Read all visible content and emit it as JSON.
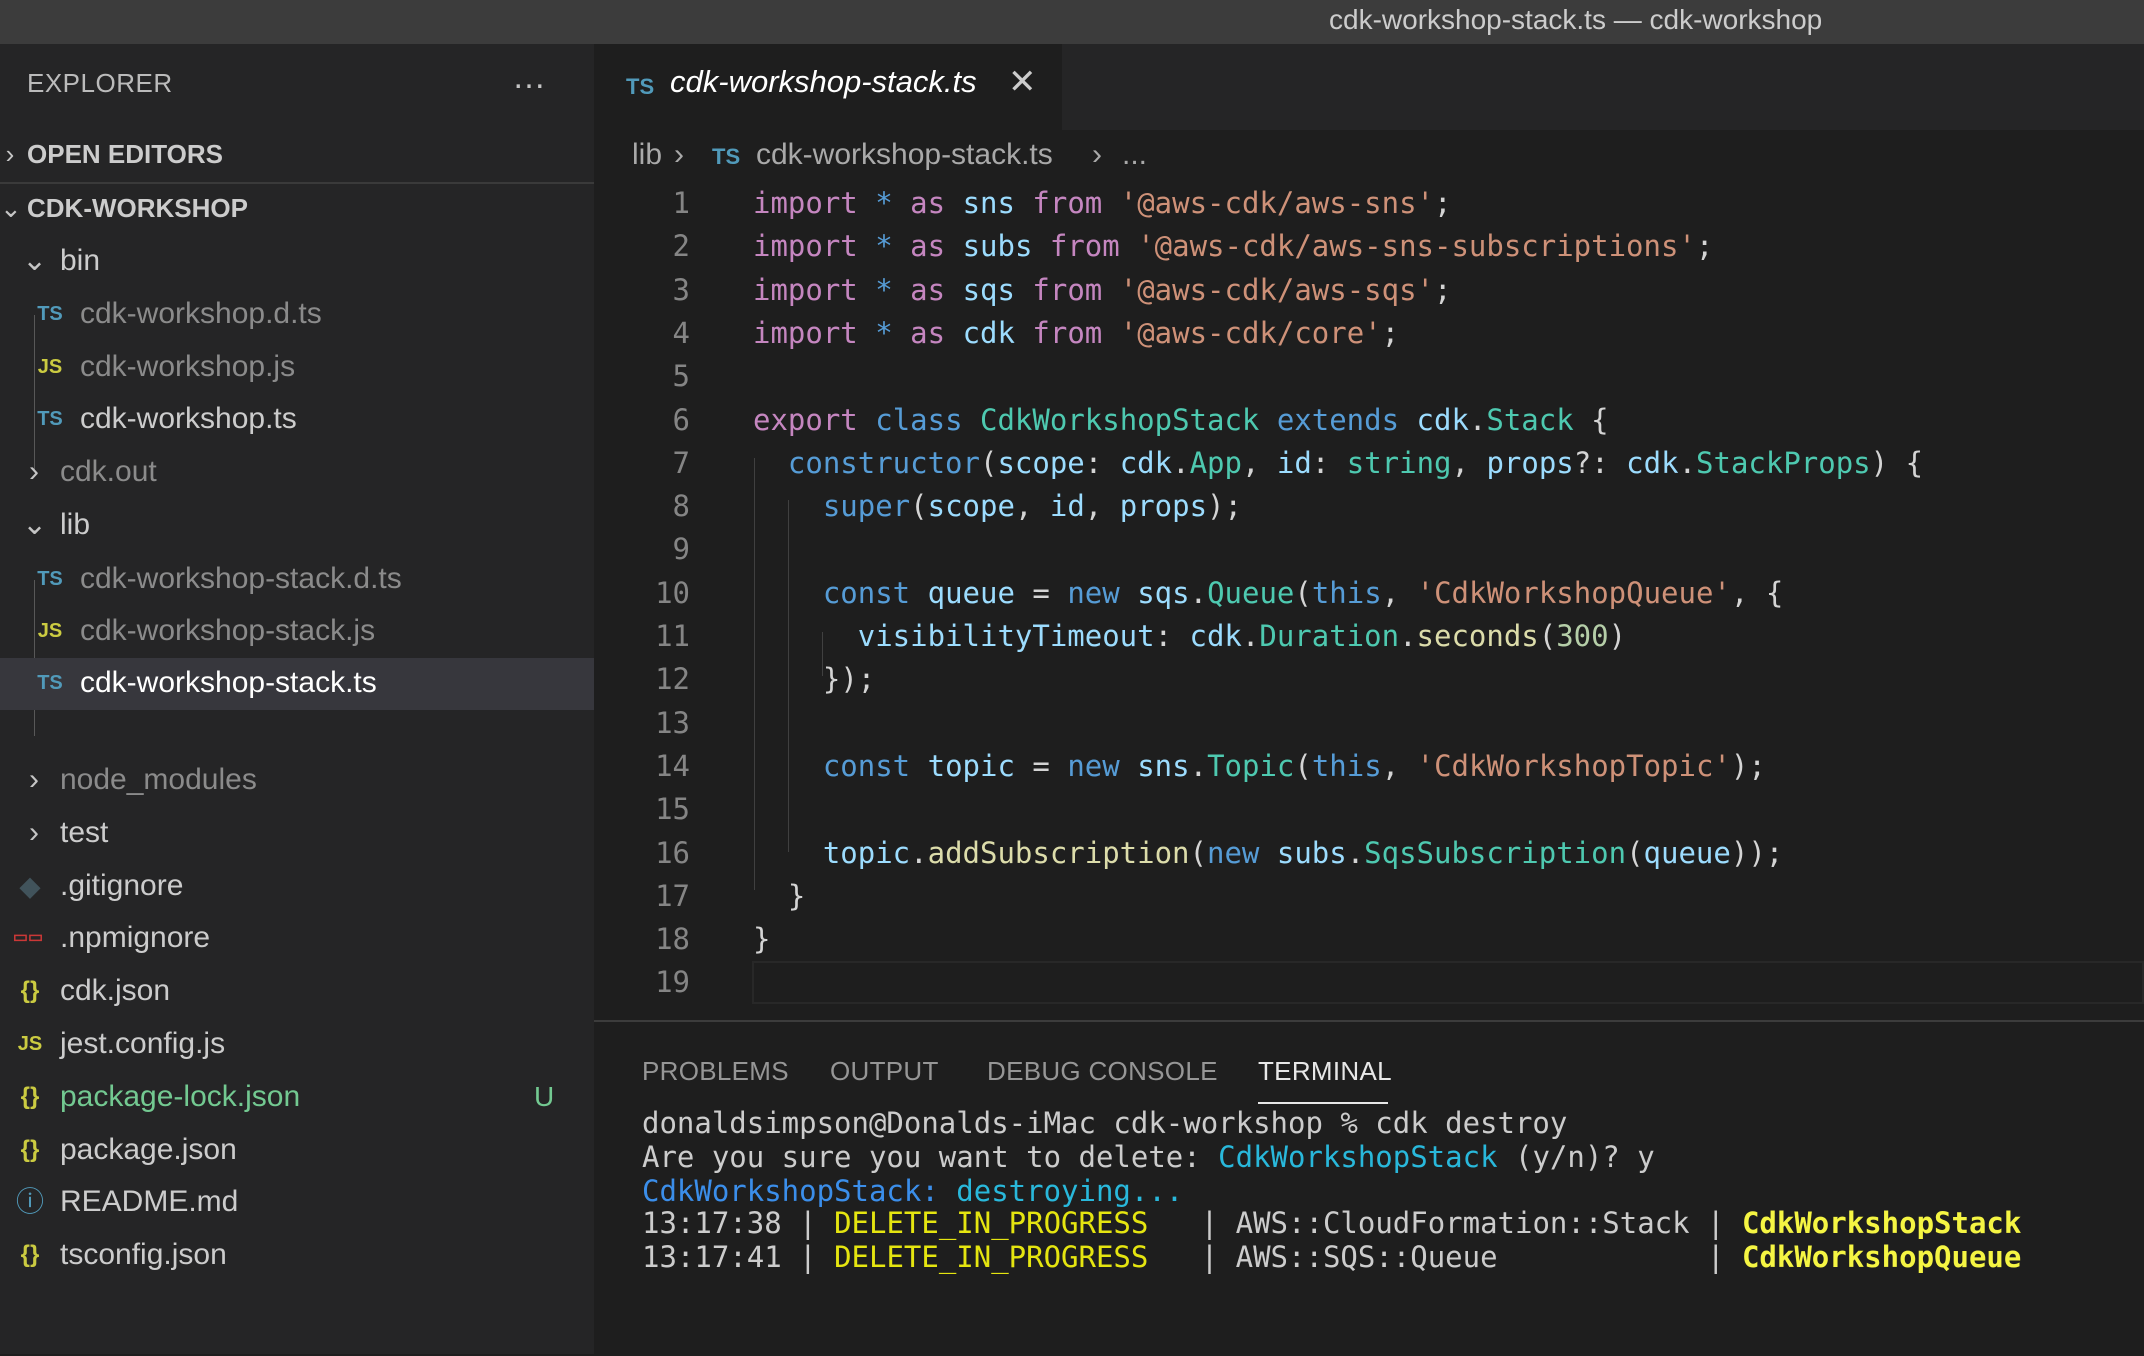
{
  "window": {
    "title": "cdk-workshop-stack.ts — cdk-workshop"
  },
  "sidebar": {
    "header": "EXPLORER",
    "more_icon": "…",
    "sections": {
      "open_editors": "OPEN EDITORS",
      "project": "CDK-WORKSHOP"
    },
    "items": [
      {
        "label": "bin",
        "kind": "folder-open"
      },
      {
        "label": "cdk-workshop.d.ts",
        "kind": "ts"
      },
      {
        "label": "cdk-workshop.js",
        "kind": "js"
      },
      {
        "label": "cdk-workshop.ts",
        "kind": "ts"
      },
      {
        "label": "cdk.out",
        "kind": "folder-closed"
      },
      {
        "label": "lib",
        "kind": "folder-open"
      },
      {
        "label": "cdk-workshop-stack.d.ts",
        "kind": "ts"
      },
      {
        "label": "cdk-workshop-stack.js",
        "kind": "js"
      },
      {
        "label": "cdk-workshop-stack.ts",
        "kind": "ts"
      },
      {
        "label": "node_modules",
        "kind": "folder-closed"
      },
      {
        "label": "test",
        "kind": "folder-closed"
      },
      {
        "label": ".gitignore",
        "kind": "git"
      },
      {
        "label": ".npmignore",
        "kind": "npm"
      },
      {
        "label": "cdk.json",
        "kind": "json"
      },
      {
        "label": "jest.config.js",
        "kind": "js"
      },
      {
        "label": "package-lock.json",
        "kind": "json",
        "badge": "U"
      },
      {
        "label": "package.json",
        "kind": "json"
      },
      {
        "label": "README.md",
        "kind": "info"
      },
      {
        "label": "tsconfig.json",
        "kind": "json"
      }
    ]
  },
  "icons": {
    "ts": "TS",
    "js": "JS",
    "json": "{}",
    "info": "ⓘ",
    "close": "✕",
    "chevron_right": "›"
  },
  "editor": {
    "tab_label": "cdk-workshop-stack.ts",
    "breadcrumb": {
      "folder": "lib",
      "file": "cdk-workshop-stack.ts",
      "more": "..."
    },
    "line_numbers": [
      "1",
      "2",
      "3",
      "4",
      "5",
      "6",
      "7",
      "8",
      "9",
      "10",
      "11",
      "12",
      "13",
      "14",
      "15",
      "16",
      "17",
      "18",
      "19"
    ],
    "lines": [
      "import * as sns from '@aws-cdk/aws-sns';",
      "import * as subs from '@aws-cdk/aws-sns-subscriptions';",
      "import * as sqs from '@aws-cdk/aws-sqs';",
      "import * as cdk from '@aws-cdk/core';",
      "",
      "export class CdkWorkshopStack extends cdk.Stack {",
      "  constructor(scope: cdk.App, id: string, props?: cdk.StackProps) {",
      "    super(scope, id, props);",
      "",
      "    const queue = new sqs.Queue(this, 'CdkWorkshopQueue', {",
      "      visibilityTimeout: cdk.Duration.seconds(300)",
      "    });",
      "",
      "    const topic = new sns.Topic(this, 'CdkWorkshopTopic');",
      "",
      "    topic.addSubscription(new subs.SqsSubscription(queue));",
      "  }",
      "}",
      ""
    ]
  },
  "panel": {
    "tabs": [
      "PROBLEMS",
      "OUTPUT",
      "DEBUG CONSOLE",
      "TERMINAL"
    ],
    "active_tab": "TERMINAL",
    "terminal": [
      "donaldsimpson@Donalds-iMac cdk-workshop % cdk destroy",
      "Are you sure you want to delete: CdkWorkshopStack (y/n)? y",
      "CdkWorkshopStack: destroying...",
      "13:17:38 | DELETE_IN_PROGRESS   | AWS::CloudFormation::Stack | CdkWorkshopStack",
      "13:17:41 | DELETE_IN_PROGRESS   | AWS::SQS::Queue            | CdkWorkshopQueue"
    ]
  },
  "colors": {
    "background": "#1e1e1e",
    "sidebar": "#252526",
    "selection": "#37373d",
    "ts_icon": "#519aba",
    "js_icon": "#cbcb41",
    "untracked": "#73c991"
  }
}
